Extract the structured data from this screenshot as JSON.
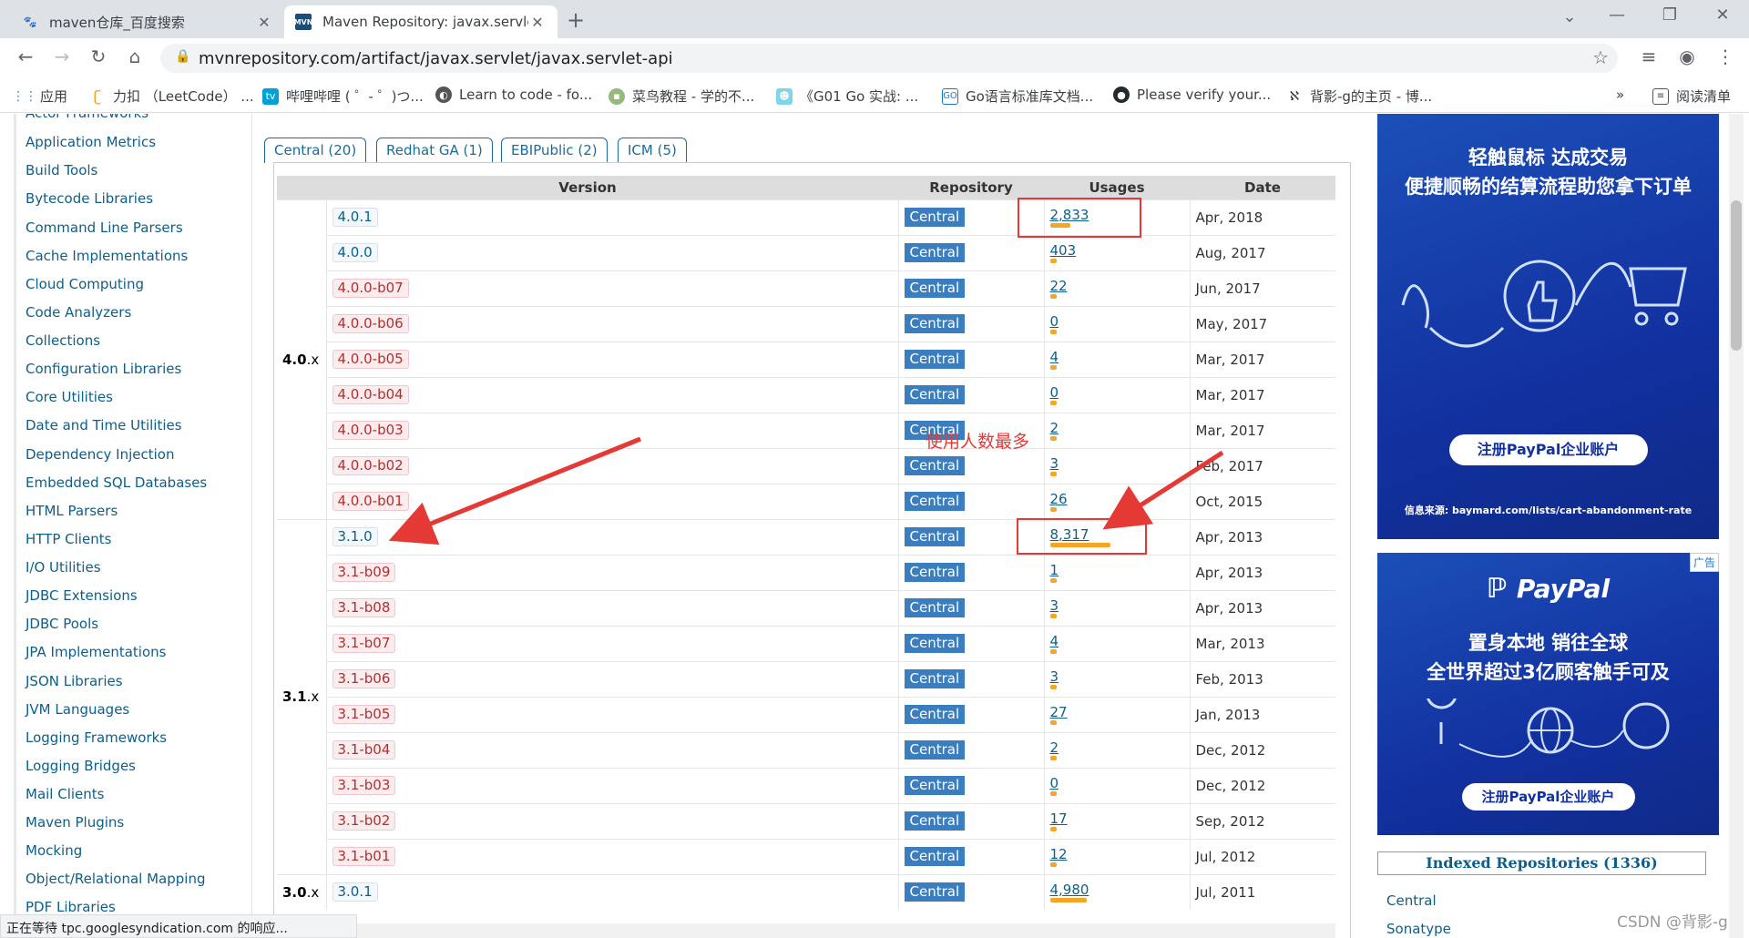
{
  "tabs": [
    {
      "title": "maven仓库_百度搜索",
      "icon": "baidu-paw-icon"
    },
    {
      "title": "Maven Repository: javax.servle",
      "icon": "mvn-logo-icon"
    }
  ],
  "address_bar": {
    "url": "mvnrepository.com/artifact/javax.servlet/javax.servlet-api"
  },
  "bookmarks": [
    {
      "label": "应用",
      "icon": "apps-grid-icon"
    },
    {
      "label": "力扣 （LeetCode） ...",
      "icon": "leetcode-icon"
    },
    {
      "label": "哔哩哔哩 ( ゜- ゜)つ...",
      "icon": "bilibili-icon"
    },
    {
      "label": "Learn to code - fo...",
      "icon": "fcc-icon"
    },
    {
      "label": "菜鸟教程 - 学的不...",
      "icon": "runoob-icon"
    },
    {
      "label": "《G01 Go 实战: ...",
      "icon": "go-gopher-icon"
    },
    {
      "label": "Go语言标准库文档...",
      "icon": "go-docs-icon"
    },
    {
      "label": "Please verify your...",
      "icon": "github-icon"
    },
    {
      "label": "背影-g的主页 - 博...",
      "icon": "cnblogs-icon"
    },
    {
      "label": "阅读清单",
      "icon": "reading-list-icon"
    }
  ],
  "sidebar": {
    "categories": [
      "Actor Frameworks",
      "Application Metrics",
      "Build Tools",
      "Bytecode Libraries",
      "Command Line Parsers",
      "Cache Implementations",
      "Cloud Computing",
      "Code Analyzers",
      "Collections",
      "Configuration Libraries",
      "Core Utilities",
      "Date and Time Utilities",
      "Dependency Injection",
      "Embedded SQL Databases",
      "HTML Parsers",
      "HTTP Clients",
      "I/O Utilities",
      "JDBC Extensions",
      "JDBC Pools",
      "JPA Implementations",
      "JSON Libraries",
      "JVM Languages",
      "Logging Frameworks",
      "Logging Bridges",
      "Mail Clients",
      "Maven Plugins",
      "Mocking",
      "Object/Relational Mapping",
      "PDF Libraries"
    ]
  },
  "repo_tabs": [
    "Central (20)",
    "Redhat GA (1)",
    "EBIPublic (2)",
    "ICM (5)"
  ],
  "table": {
    "headers": {
      "version": "Version",
      "repository": "Repository",
      "usages": "Usages",
      "date": "Date"
    },
    "groups": [
      {
        "label": "4.0",
        "suffix": ".x",
        "rows": [
          {
            "version": "4.0.1",
            "style": "blue",
            "repo": "Central",
            "usages": "2,833",
            "usage_value": 2833,
            "date": "Apr, 2018"
          },
          {
            "version": "4.0.0",
            "style": "blue",
            "repo": "Central",
            "usages": "403",
            "usage_value": 403,
            "date": "Aug, 2017"
          },
          {
            "version": "4.0.0-b07",
            "style": "pink",
            "repo": "Central",
            "usages": "22",
            "usage_value": 22,
            "date": "Jun, 2017"
          },
          {
            "version": "4.0.0-b06",
            "style": "pink",
            "repo": "Central",
            "usages": "0",
            "usage_value": 0,
            "date": "May, 2017"
          },
          {
            "version": "4.0.0-b05",
            "style": "pink",
            "repo": "Central",
            "usages": "4",
            "usage_value": 4,
            "date": "Mar, 2017"
          },
          {
            "version": "4.0.0-b04",
            "style": "pink",
            "repo": "Central",
            "usages": "0",
            "usage_value": 0,
            "date": "Mar, 2017"
          },
          {
            "version": "4.0.0-b03",
            "style": "pink",
            "repo": "Central",
            "usages": "2",
            "usage_value": 2,
            "date": "Mar, 2017"
          },
          {
            "version": "4.0.0-b02",
            "style": "pink",
            "repo": "Central",
            "usages": "3",
            "usage_value": 3,
            "date": "Feb, 2017"
          },
          {
            "version": "4.0.0-b01",
            "style": "pink",
            "repo": "Central",
            "usages": "26",
            "usage_value": 26,
            "date": "Oct, 2015"
          }
        ]
      },
      {
        "label": "3.1",
        "suffix": ".x",
        "rows": [
          {
            "version": "3.1.0",
            "style": "blue",
            "repo": "Central",
            "usages": "8,317",
            "usage_value": 8317,
            "date": "Apr, 2013"
          },
          {
            "version": "3.1-b09",
            "style": "pink",
            "repo": "Central",
            "usages": "1",
            "usage_value": 1,
            "date": "Apr, 2013"
          },
          {
            "version": "3.1-b08",
            "style": "pink",
            "repo": "Central",
            "usages": "3",
            "usage_value": 3,
            "date": "Apr, 2013"
          },
          {
            "version": "3.1-b07",
            "style": "pink",
            "repo": "Central",
            "usages": "4",
            "usage_value": 4,
            "date": "Mar, 2013"
          },
          {
            "version": "3.1-b06",
            "style": "pink",
            "repo": "Central",
            "usages": "3",
            "usage_value": 3,
            "date": "Feb, 2013"
          },
          {
            "version": "3.1-b05",
            "style": "pink",
            "repo": "Central",
            "usages": "27",
            "usage_value": 27,
            "date": "Jan, 2013"
          },
          {
            "version": "3.1-b04",
            "style": "pink",
            "repo": "Central",
            "usages": "2",
            "usage_value": 2,
            "date": "Dec, 2012"
          },
          {
            "version": "3.1-b03",
            "style": "pink",
            "repo": "Central",
            "usages": "0",
            "usage_value": 0,
            "date": "Dec, 2012"
          },
          {
            "version": "3.1-b02",
            "style": "pink",
            "repo": "Central",
            "usages": "17",
            "usage_value": 17,
            "date": "Sep, 2012"
          },
          {
            "version": "3.1-b01",
            "style": "pink",
            "repo": "Central",
            "usages": "12",
            "usage_value": 12,
            "date": "Jul, 2012"
          }
        ]
      },
      {
        "label": "3.0",
        "suffix": ".x",
        "rows": [
          {
            "version": "3.0.1",
            "style": "blue",
            "repo": "Central",
            "usages": "4,980",
            "usage_value": 4980,
            "date": "Jul, 2011"
          }
        ]
      }
    ]
  },
  "annotation": {
    "text": "使用人数最多",
    "color": "#e53935"
  },
  "ads": {
    "ad1": {
      "headline1": "轻触鼠标 达成交易",
      "headline2": "便捷顺畅的结算流程助您拿下订单",
      "button": "注册PayPal企业账户",
      "source": "信息来源: baymard.com/lists/cart-abandonment-rate"
    },
    "ad2": {
      "badge": "广告",
      "brand": "PayPal",
      "headline1": "置身本地 销往全球",
      "headline2": "全世界超过3亿顾客触手可及",
      "button": "注册PayPal企业账户"
    }
  },
  "indexed": {
    "title": "Indexed Repositories (1336)",
    "items": [
      "Central",
      "Sonatype"
    ]
  },
  "status_bar": "正在等待 tpc.googlesyndication.com 的响应...",
  "watermark": "CSDN @背影-g",
  "colors": {
    "accent": "#0e5e8a",
    "repo_badge": "#3b7ebf",
    "usage_bar": "#f5a623",
    "annotation": "#e53935",
    "ad_bg": "#1231a0"
  }
}
